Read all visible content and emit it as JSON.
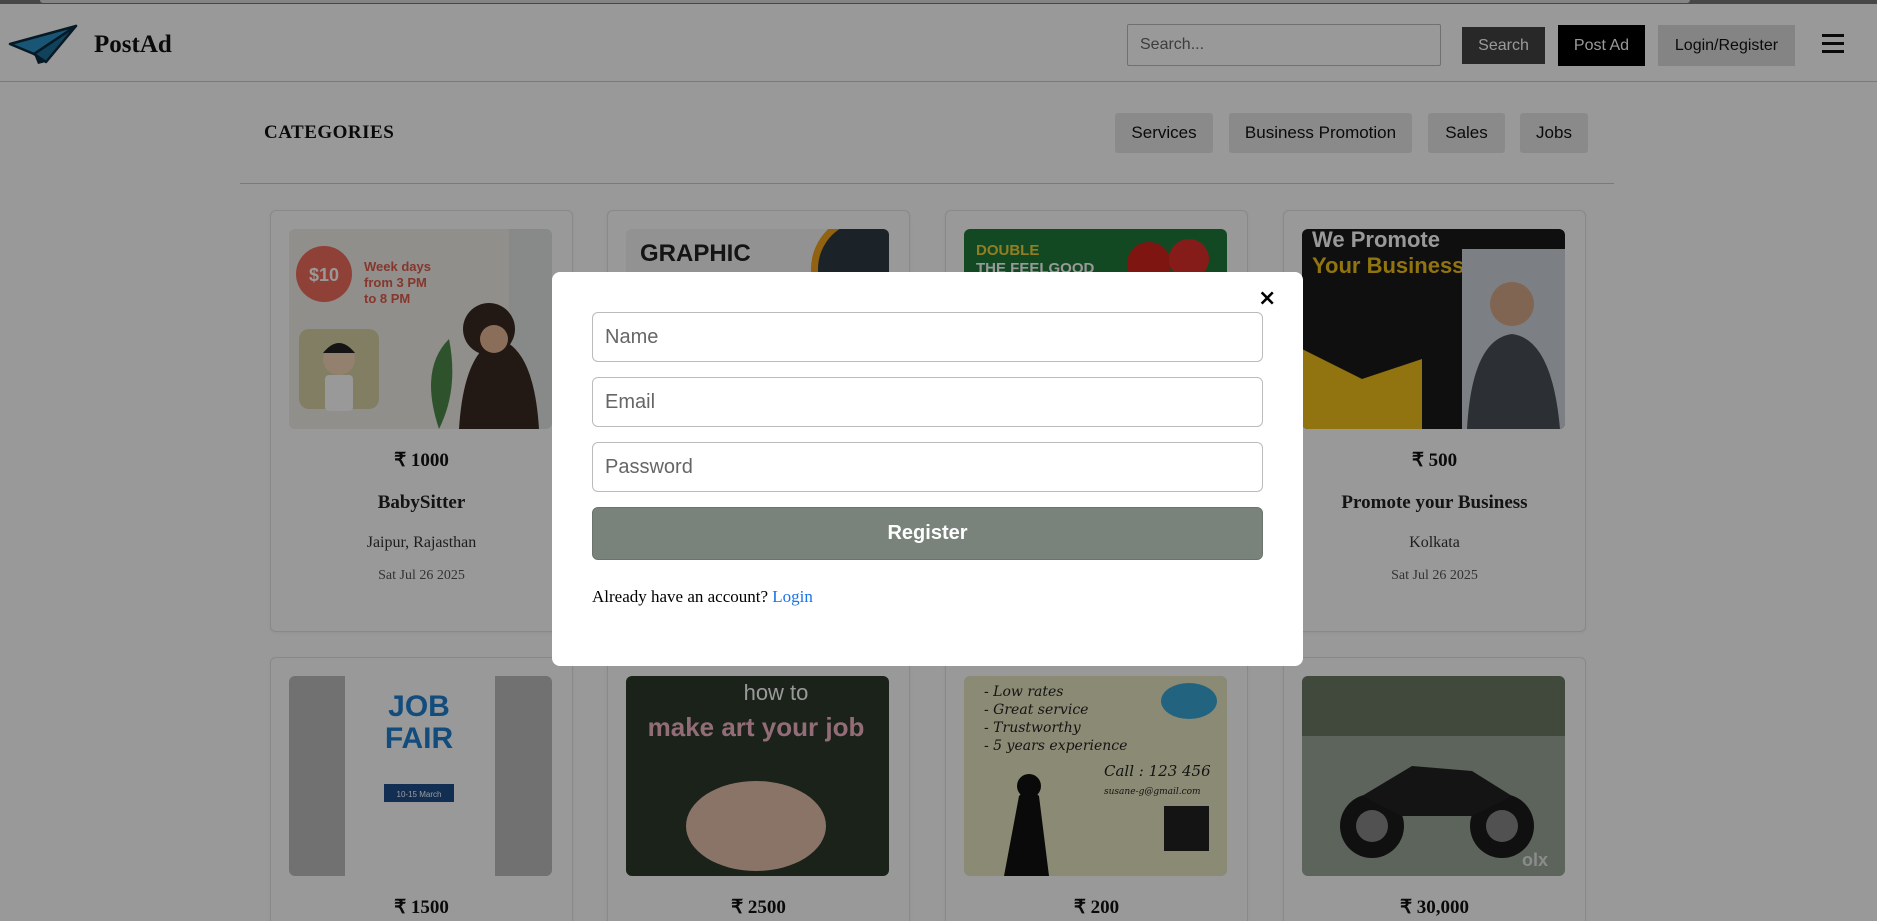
{
  "header": {
    "brand": "PostAd",
    "search_placeholder": "Search...",
    "search_label": "Search",
    "post_ad_label": "Post Ad",
    "login_label": "Login/Register",
    "menu_icon": "hamburger-icon"
  },
  "categories": {
    "title": "CATEGORIES",
    "chips": [
      "Services",
      "Business Promotion",
      "Sales",
      "Jobs"
    ]
  },
  "cards": [
    {
      "price": "₹ 1000",
      "title": "BabySitter",
      "location": "Jaipur, Rajasthan",
      "date": "Sat Jul 26 2025",
      "image_text": [
        "$10",
        "Week days",
        "from 3 PM",
        "to 8 PM"
      ]
    },
    {
      "price": "",
      "title": "",
      "location": "",
      "date": "",
      "image_text": [
        "GRAPHIC"
      ]
    },
    {
      "price": "",
      "title": "",
      "location": "",
      "date": "",
      "image_text": [
        "DOUBLE",
        "THE FEELGOOD"
      ]
    },
    {
      "price": "₹ 500",
      "title": "Promote your Business",
      "location": "Kolkata",
      "date": "Sat Jul 26 2025",
      "image_text": [
        "We Promote",
        "Your Business"
      ]
    },
    {
      "price": "₹ 1500",
      "title": "",
      "location": "",
      "date": "",
      "image_text": [
        "JOB",
        "FAIR",
        "10-15 March"
      ]
    },
    {
      "price": "₹ 2500",
      "title": "",
      "location": "",
      "date": "",
      "image_text": [
        "how to",
        "make art your job"
      ]
    },
    {
      "price": "₹ 200",
      "title": "",
      "location": "",
      "date": "",
      "image_text": [
        "- Low rates",
        "- Great service",
        "- Trustworthy",
        "- 5 years experience",
        "Call : 123 456",
        "susane-g@gmail.com"
      ]
    },
    {
      "price": "₹ 30,000",
      "title": "",
      "location": "",
      "date": "",
      "image_text": [
        "olx"
      ]
    }
  ],
  "modal": {
    "close_label": "×",
    "name_placeholder": "Name",
    "email_placeholder": "Email",
    "password_placeholder": "Password",
    "register_label": "Register",
    "already_text": "Already have an account?",
    "login_link": "Login"
  },
  "colors": {
    "register_bg": "#7a837b",
    "link": "#1a73e8",
    "overlay": "rgba(0,0,0,0.4)"
  }
}
